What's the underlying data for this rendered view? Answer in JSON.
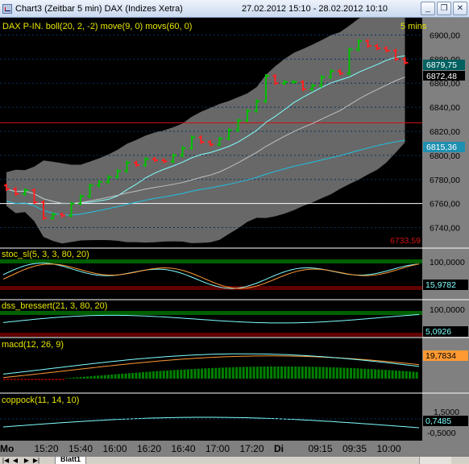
{
  "window": {
    "title": "Chart3 (Zeitbar 5 min)  DAX (Indizes Xetra)",
    "date_range": "27.02.2012 15:10 - 28.02.2012 10:10",
    "min_label": "_",
    "restore_label": "❐",
    "close_label": "✕"
  },
  "colors": {
    "background": "#000000",
    "up_bar": "#00c000",
    "down_bar": "#ff2020",
    "bollinger_fill": "#7a7a7a",
    "ma_fast": "#80ffff",
    "ma_slow": "#20c0e0",
    "grid": "#003366",
    "ruler": "#808080",
    "overbought_zone": "#006000",
    "oversold_zone": "#600000"
  },
  "main_panel": {
    "legend": "DAX P-IN. boll(20, 2, -2) move(9, 0) movs(60, 0)",
    "timeframe": "5 mins",
    "price_ticks": [
      "6900,00",
      "6880,00",
      "6860,00",
      "6840,00",
      "6820,00",
      "6800,00",
      "6780,00",
      "6760,00",
      "6740,00"
    ],
    "last_price": "6879,75",
    "upper_band_label": "6872,48",
    "ma_label": "6815,36",
    "low_label": "6733,59",
    "hline_red_level": 6827,
    "hline_white_level": 6760
  },
  "indicators": [
    {
      "legend": "stoc_sl(5, 3, 3, 80, 20)",
      "tick_top": "100,0000",
      "value": "15,9782",
      "value_color": "#80ffff"
    },
    {
      "legend": "dss_bressert(21, 3, 80, 20)",
      "tick_top": "100,0000",
      "value": "5,0926",
      "value_color": "#80ffff"
    },
    {
      "legend": "macd(12, 26, 9)",
      "tick_top": "",
      "value": "19,7834",
      "value_color": "#ff9933"
    },
    {
      "legend": "coppock(11, 14, 10)",
      "tick_top": "1,5000",
      "tick_bottom": "-0,5000",
      "value": "0,7485",
      "value_color": "#80ffff"
    }
  ],
  "time_axis": [
    "Mo",
    "15:20",
    "15:40",
    "16:00",
    "16:20",
    "16:40",
    "17:00",
    "17:20",
    "Di",
    "09:15",
    "09:35",
    "10:00"
  ],
  "sheets": {
    "tab": "Blatt1"
  },
  "chart_data": {
    "type": "candlestick",
    "y_range": [
      6735,
      6905
    ],
    "series": [
      {
        "name": "close",
        "values": [
          6772,
          6768,
          6771,
          6761,
          6748,
          6751,
          6750,
          6760,
          6766,
          6775,
          6778,
          6782,
          6787,
          6794,
          6792,
          6797,
          6796,
          6795,
          6800,
          6806,
          6815,
          6811,
          6809,
          6814,
          6821,
          6829,
          6837,
          6845,
          6866,
          6860,
          6861,
          6861,
          6855,
          6858,
          6865,
          6870,
          6868,
          6888,
          6895,
          6891,
          6889,
          6887,
          6880,
          6877
        ]
      }
    ]
  }
}
